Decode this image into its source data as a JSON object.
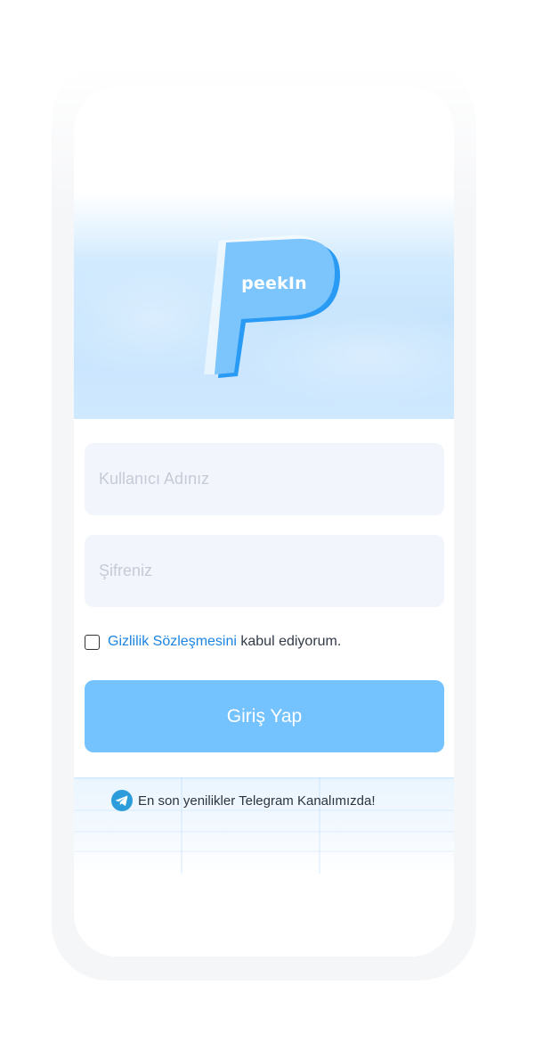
{
  "app": {
    "logo_text": "peekIn"
  },
  "login_form": {
    "username_placeholder": "Kullanıcı Adınız",
    "password_placeholder": "Şifreniz",
    "username_value": "",
    "password_value": "",
    "agreement": {
      "link_text": "Gizlilik Sözleşmesini",
      "suffix_text": "kabul ediyorum.",
      "checked": false
    },
    "submit_label": "Giriş Yap"
  },
  "telegram_banner": {
    "icon": "telegram-icon",
    "text": "En son yenilikler Telegram Kanalımızda!"
  },
  "colors": {
    "accent": "#74c2fe",
    "link": "#1c84e3",
    "input_background": "#f2f6fc",
    "hero_background": "#c6e4fd",
    "logo_blue": "#7cc4fc",
    "logo_shadow": "#2a9bf5"
  }
}
